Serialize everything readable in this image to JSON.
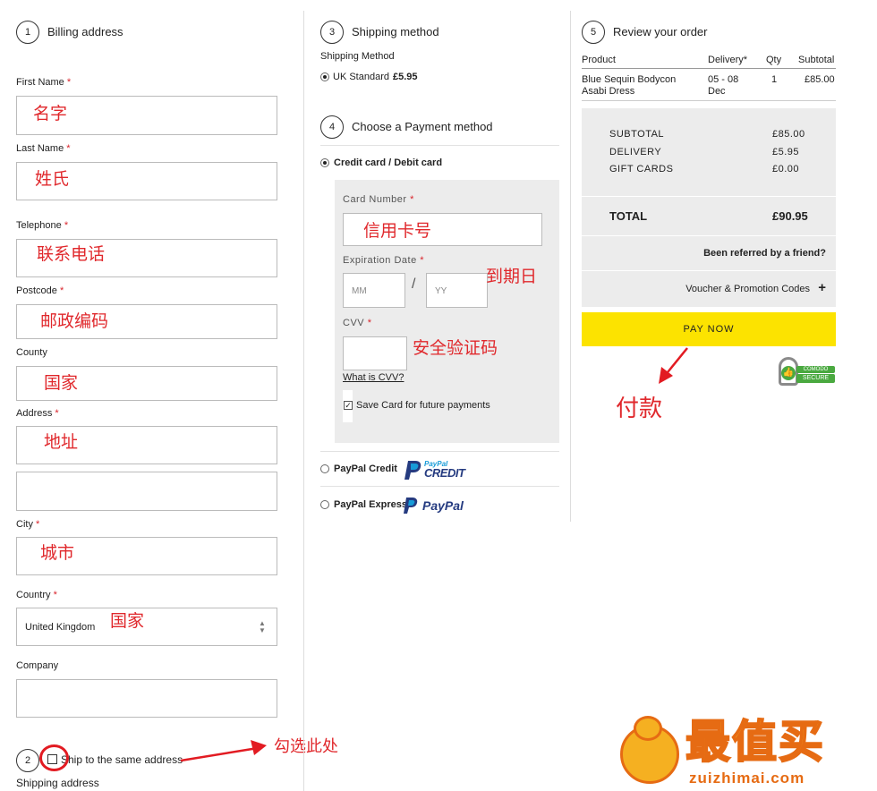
{
  "billing": {
    "step": "1",
    "title": "Billing address",
    "first_name": {
      "label": "First Name",
      "value": "名字"
    },
    "last_name": {
      "label": "Last Name",
      "value": "姓氏"
    },
    "telephone": {
      "label": "Telephone",
      "value": "联系电话"
    },
    "postcode": {
      "label": "Postcode",
      "value": "邮政编码"
    },
    "county": {
      "label": "County",
      "value": "国家"
    },
    "address": {
      "label": "Address",
      "value": "地址"
    },
    "city": {
      "label": "City",
      "value": "城市"
    },
    "country": {
      "label": "Country",
      "value": "United Kingdom",
      "note": "国家"
    },
    "company": {
      "label": "Company"
    },
    "required_mark": "*"
  },
  "shipping_address": {
    "step": "2",
    "same_address_label": "Ship to the same address",
    "title": "Shipping address",
    "annotation": "勾选此处"
  },
  "shipping_method": {
    "step": "3",
    "title": "Shipping method",
    "subtitle": "Shipping Method",
    "option_name": "UK Standard",
    "option_price": "£5.95"
  },
  "payment": {
    "step": "4",
    "title": "Choose a Payment method",
    "card_option": "Credit card / Debit card",
    "card_number": {
      "label": "Card Number",
      "value": "信用卡号"
    },
    "expiration": {
      "label": "Expiration Date",
      "mm_placeholder": "MM",
      "yy_placeholder": "YY",
      "separator": "/",
      "note": "到期日"
    },
    "cvv": {
      "label": "CVV",
      "note": "安全验证码",
      "help": "What is CVV?"
    },
    "save_card": "Save Card for future payments",
    "paypal_credit": "PayPal Credit",
    "paypal_express": "PayPal Express",
    "paypal_credit_logo_top": "PayPal",
    "paypal_credit_logo_bottom": "CREDIT",
    "paypal_logo": "PayPal"
  },
  "review": {
    "step": "5",
    "title": "Review your order",
    "headers": [
      "Product",
      "Delivery*",
      "Qty",
      "Subtotal"
    ],
    "item": {
      "product": "Blue Sequin Bodycon Asabi Dress",
      "delivery": "05 - 08 Dec",
      "qty": "1",
      "subtotal": "£85.00"
    },
    "subtotal_label": "SUBTOTAL",
    "subtotal_value": "£85.00",
    "delivery_label": "DELIVERY",
    "delivery_value": "£5.95",
    "gift_label": "GIFT CARDS",
    "gift_value": "£0.00",
    "total_label": "TOTAL",
    "total_value": "£90.95",
    "referred": "Been referred by a friend?",
    "voucher": "Voucher & Promotion Codes",
    "voucher_icon": "+",
    "pay_now": "PAY NOW",
    "pay_note": "付款",
    "secure_badge_top": "COMODO",
    "secure_badge_bottom": "SECURE"
  },
  "watermark": {
    "brand": "最值买",
    "domain": "zuizhimai.com"
  },
  "colors": {
    "accent_yellow": "#fce300",
    "annotation_red": "#e0282c",
    "panel_grey": "#ececec"
  }
}
